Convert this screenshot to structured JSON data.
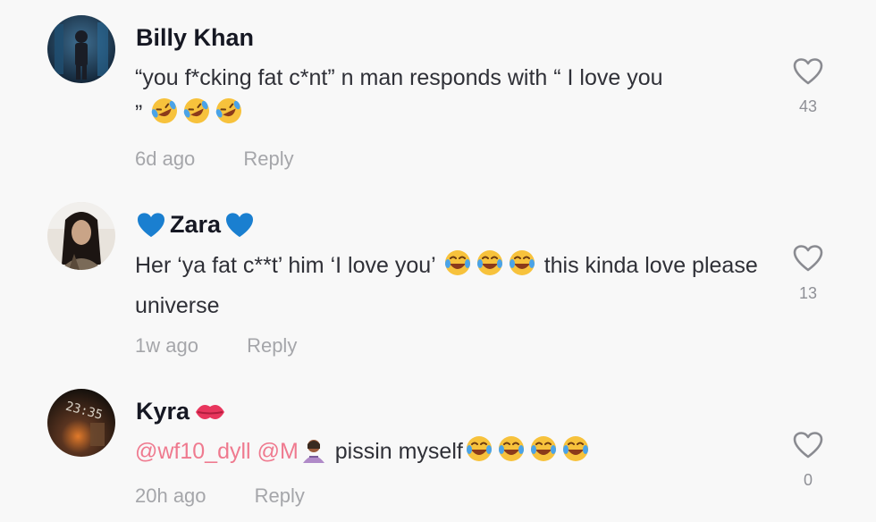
{
  "comments": [
    {
      "author": "Billy Khan",
      "text_part1": "“you f*cking fat c*nt” n man responds with “ I love you",
      "text_part2": "”",
      "time": "6d ago",
      "reply_label": "Reply",
      "likes": "43",
      "emojis": [
        "rofl-emoji",
        "rofl-emoji",
        "rofl-emoji"
      ]
    },
    {
      "author": "Zara",
      "text_part1": "Her ‘ya fat c**t’ him ‘I love you’",
      "text_part2": "this kinda love please universe",
      "time": "1w ago",
      "reply_label": "Reply",
      "likes": "13",
      "emojis": [
        "tears-of-joy-emoji",
        "tears-of-joy-emoji",
        "tears-of-joy-emoji"
      ],
      "name_decoration": "blue-heart-icon"
    },
    {
      "author": "Kyra",
      "mention1": "@wf10_dyll",
      "mention2": "@M",
      "text_part1": "pissin myself",
      "time": "20h ago",
      "reply_label": "Reply",
      "likes": "0",
      "emojis": [
        "woman-emoji",
        "tears-of-joy-emoji",
        "tears-of-joy-emoji",
        "tears-of-joy-emoji",
        "tears-of-joy-emoji"
      ],
      "name_decoration": "kiss-mark-icon"
    }
  ],
  "colors": {
    "background": "#f8f8f8",
    "name": "#161823",
    "body": "#2f3037",
    "meta": "#a5a6aa",
    "mention": "#ef7a8f",
    "heart_blue": "#1a7fd0"
  }
}
